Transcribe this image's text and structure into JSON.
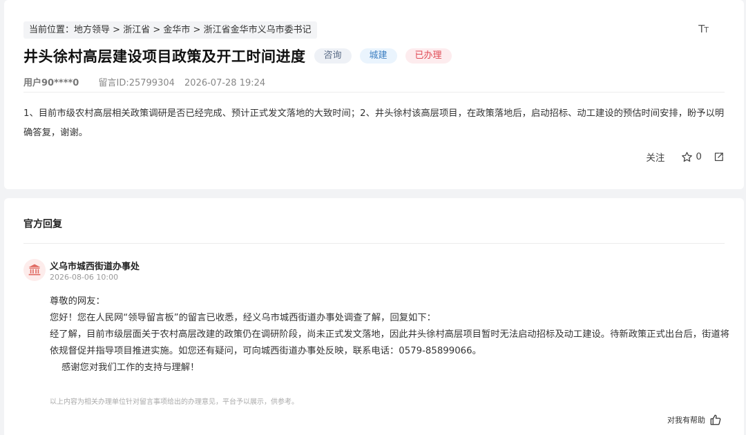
{
  "breadcrumb": {
    "prefix": "当前位置：",
    "items": [
      "地方领导",
      "浙江省",
      "金华市",
      "浙江省金华市义乌市委书记"
    ],
    "separator": " > "
  },
  "font_toggle": {
    "icon": "font-size-icon",
    "label_big": "T",
    "label_small": "T"
  },
  "post": {
    "title": "井头徐村高层建设项目政策及开工时间进度",
    "tags": [
      {
        "label": "咨询",
        "color": "#5a6b86"
      },
      {
        "label": "城建",
        "color": "#3d7fc2"
      },
      {
        "label": "已办理",
        "color": "#e04a55"
      }
    ],
    "user": "用户90****0",
    "message_id": "留言ID:25799304",
    "datetime": "2026-07-28 19:24",
    "content": "1、目前市级农村高层相关政策调研是否已经完成、预计正式发文落地的大致时间；2、井头徐村该高层项目，在政策落地后，启动招标、动工建设的预估时间安排，盼予以明确答复，谢谢。"
  },
  "actions": {
    "follow_label": "关注",
    "star_icon": "star-icon",
    "star_count": "0",
    "share_icon": "share-icon"
  },
  "official_reply": {
    "section_title": "官方回复",
    "avatar_icon": "government-building-icon",
    "department": "义乌市城西街道办事处",
    "datetime": "2026-08-06 10:00",
    "paragraphs": [
      "尊敬的网友：",
      "您好！您在人民网“领导留言板”的留言已收悉，经义乌市城西街道办事处调查了解，回复如下：",
      "经了解，目前市级层面关于农村高层改建的政策仍在调研阶段，尚未正式发文落地，因此井头徐村高层项目暂时无法启动招标及动工建设。待新政策正式出台后，街道将依规督促并指导项目推进实施。如您还有疑问，可向城西街道办事处反映，联系电话：0579-85899066。",
      "感谢您对我们工作的支持与理解！"
    ],
    "disclaimer": "以上内容为相关办理单位针对留言事项给出的办理意见，平台予以展示，供参考。",
    "helpful_label": "对我有帮助",
    "helpful_icon": "thumbs-up-icon"
  },
  "colors": {
    "accent_red": "#e04a55",
    "accent_blue": "#3d7fc2",
    "background": "#f2f3f5"
  }
}
